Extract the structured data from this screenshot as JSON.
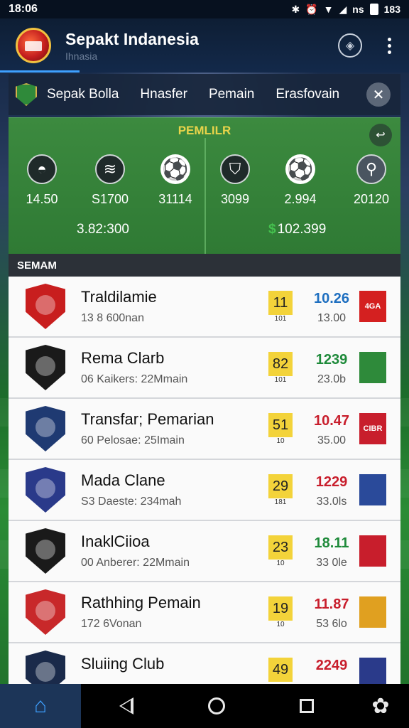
{
  "status": {
    "time": "18:06",
    "signal_text": "ns",
    "battery": "183"
  },
  "appbar": {
    "title": "Sepakt Indanesia",
    "subtitle": "Ihnasia"
  },
  "tabs": [
    "Sepak Bolla",
    "Hnasfer",
    "Pemain",
    "Erasfovain"
  ],
  "panel": {
    "title": "PEMLILR",
    "stats": [
      "14.50",
      "S1700",
      "31114",
      "3099",
      "2.994",
      "20120"
    ],
    "total_left": "3.82:300",
    "total_right": "102.399"
  },
  "section_title": "SEMAM",
  "rows": [
    {
      "name": "Traldilamie",
      "meta": "13 8 600nan",
      "badge": "11",
      "badge_sub": "101",
      "score": "10.26",
      "score_color": "#1e6fc0",
      "amount": "13.00",
      "crest": "#c81e1e",
      "mini_text": "4GA",
      "mini_color": "#d42020"
    },
    {
      "name": "Rema Clarb",
      "meta": "06 Kaikers: 22Mmain",
      "badge": "82",
      "badge_sub": "101",
      "score": "1239",
      "score_color": "#1e8a3a",
      "amount": "23.0b",
      "crest": "#1a1a1a",
      "mini_text": "",
      "mini_color": "#2e8a3a"
    },
    {
      "name": "Transfar; Pemarian",
      "meta": "60 Pelosae: 25Imain",
      "badge": "51",
      "badge_sub": "10",
      "score": "10.47",
      "score_color": "#c81e2c",
      "amount": "35.00",
      "crest": "#1f3a72",
      "mini_text": "CIBR",
      "mini_color": "#c81e2c"
    },
    {
      "name": "Mada Clane",
      "meta": "S3 Daeste: 234mah",
      "badge": "29",
      "badge_sub": "181",
      "score": "1229",
      "score_color": "#c81e2c",
      "amount": "33.0ls",
      "crest": "#2a3a8a",
      "mini_text": "",
      "mini_color": "#2a4a9a"
    },
    {
      "name": "InaklCiioa",
      "meta": "00 Anberer: 22Mmain",
      "badge": "23",
      "badge_sub": "10",
      "score": "18.11",
      "score_color": "#1e8a3a",
      "amount": "33 0le",
      "crest": "#1a1a1a",
      "mini_text": "",
      "mini_color": "#c81e2c"
    },
    {
      "name": "Rathhing Pemain",
      "meta": "172 6Vonan",
      "badge": "19",
      "badge_sub": "10",
      "score": "11.87",
      "score_color": "#c81e2c",
      "amount": "53 6lo",
      "crest": "#c8282a",
      "mini_text": "",
      "mini_color": "#e0a020"
    },
    {
      "name": "Sluiing Club",
      "meta": "",
      "badge": "49",
      "badge_sub": "",
      "score": "2249",
      "score_color": "#c81e2c",
      "amount": "",
      "crest": "#1a2a4a",
      "mini_text": "",
      "mini_color": "#2a3a8a"
    }
  ]
}
